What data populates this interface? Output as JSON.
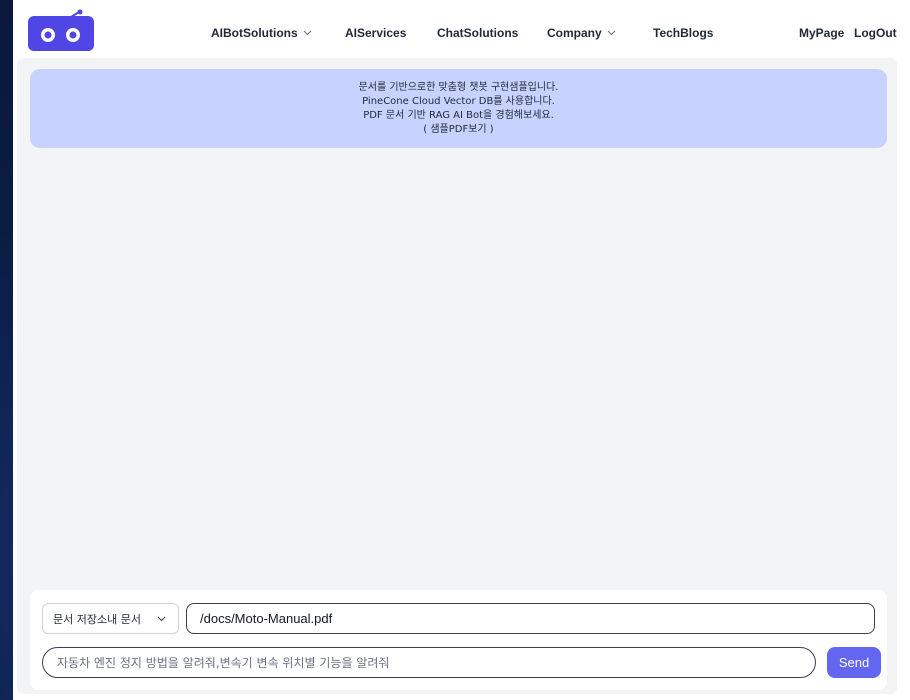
{
  "header": {
    "nav": [
      {
        "label": "AIBotSolutions",
        "has_dropdown": true
      },
      {
        "label": "AIServices",
        "has_dropdown": false
      },
      {
        "label": "ChatSolutions",
        "has_dropdown": false
      },
      {
        "label": "Company",
        "has_dropdown": true
      },
      {
        "label": "TechBlogs",
        "has_dropdown": false
      }
    ],
    "user_links": {
      "mypage": "MyPage",
      "logout": "LogOut"
    }
  },
  "banner": {
    "line1": "문서를 기반으로한 맞춤형 챗봇 구현샘플입니다.",
    "line2": "PineCone Cloud Vector DB를 사용합니다.",
    "line3": "PDF 문서 기반 RAG AI Bot을 경험해보세요.",
    "line4": "( 샘플PDF보기 )"
  },
  "input_panel": {
    "source_select": {
      "selected": "문서 저장소내 문서"
    },
    "path_value": "/docs/Moto-Manual.pdf",
    "question_placeholder": "자동차 엔진 정지 방법을 알려줘,변속기 변속 위치별 기능을 알려줘",
    "send_label": "Send"
  },
  "colors": {
    "accent": "#6366f1",
    "banner_bg": "#c7d2fe",
    "content_bg": "#f3f4f6",
    "desktop_bg": "#0b1c44"
  },
  "icons": {
    "logo": "robot-logo-icon",
    "dropdown": "chevron-down-icon"
  }
}
